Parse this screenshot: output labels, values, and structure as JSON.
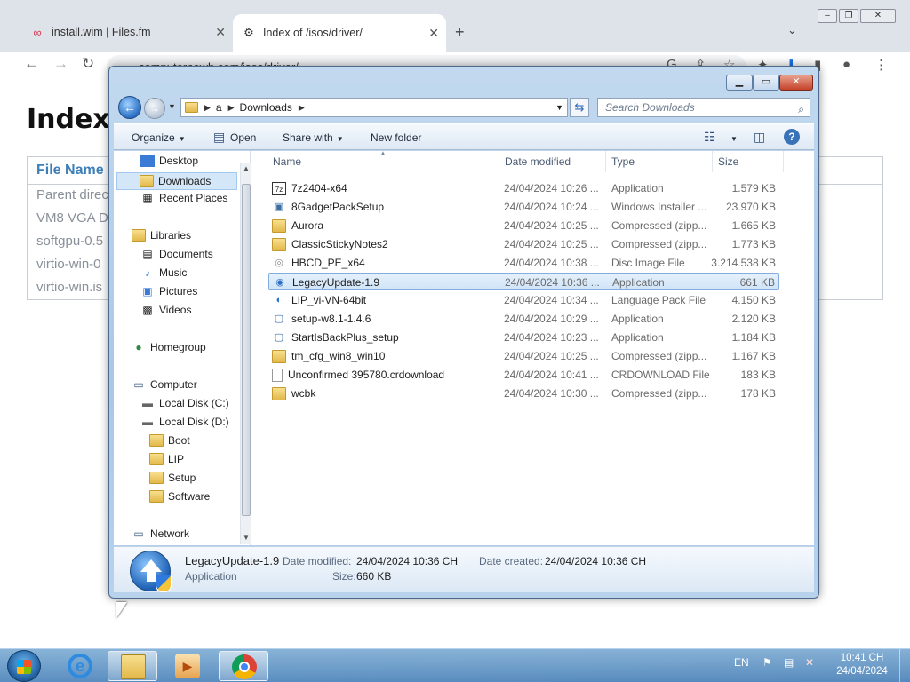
{
  "browser": {
    "tabs": [
      {
        "title": "install.wim | Files.fm",
        "icon": "files-fm-icon"
      },
      {
        "title": "Index of /isos/driver/",
        "icon": "server-icon"
      }
    ],
    "url": "computernewb.com/isos/driver/",
    "page": {
      "title": "Index",
      "column_header": "File Name",
      "rows": [
        "Parent direc",
        "VM8 VGA D",
        "softgpu-0.5",
        "virtio-win-0",
        "virtio-win.is"
      ]
    }
  },
  "explorer": {
    "breadcrumb": [
      "a",
      "Downloads"
    ],
    "search_placeholder": "Search Downloads",
    "commands": {
      "organize": "Organize",
      "open": "Open",
      "share_with": "Share with",
      "new_folder": "New folder"
    },
    "nav": {
      "favorites": [
        "Desktop",
        "Downloads",
        "Recent Places"
      ],
      "libraries": "Libraries",
      "library_items": [
        "Documents",
        "Music",
        "Pictures",
        "Videos"
      ],
      "homegroup": "Homegroup",
      "computer": "Computer",
      "drives": [
        "Local Disk (C:)",
        "Local Disk (D:)"
      ],
      "d_folders": [
        "Boot",
        "LIP",
        "Setup",
        "Software"
      ],
      "network": "Network"
    },
    "columns": {
      "name": "Name",
      "date": "Date modified",
      "type": "Type",
      "size": "Size"
    },
    "files": [
      {
        "name": "7z2404-x64",
        "date": "24/04/2024 10:26 ...",
        "type": "Application",
        "size": "1.579 KB",
        "icon": "app-icon"
      },
      {
        "name": "8GadgetPackSetup",
        "date": "24/04/2024 10:24 ...",
        "type": "Windows Installer ...",
        "size": "23.970 KB",
        "icon": "installer-icon"
      },
      {
        "name": "Aurora",
        "date": "24/04/2024 10:25 ...",
        "type": "Compressed (zipp...",
        "size": "1.665 KB",
        "icon": "zip-folder-icon"
      },
      {
        "name": "ClassicStickyNotes2",
        "date": "24/04/2024 10:25 ...",
        "type": "Compressed (zipp...",
        "size": "1.773 KB",
        "icon": "zip-folder-icon"
      },
      {
        "name": "HBCD_PE_x64",
        "date": "24/04/2024 10:38 ...",
        "type": "Disc Image File",
        "size": "3.214.538 KB",
        "icon": "disc-image-icon"
      },
      {
        "name": "LegacyUpdate-1.9",
        "date": "24/04/2024 10:36 ...",
        "type": "Application",
        "size": "661 KB",
        "icon": "legacy-update-icon"
      },
      {
        "name": "LIP_vi-VN-64bit",
        "date": "24/04/2024 10:34 ...",
        "type": "Language Pack File",
        "size": "4.150 KB",
        "icon": "language-pack-icon"
      },
      {
        "name": "setup-w8.1-1.4.6",
        "date": "24/04/2024 10:29 ...",
        "type": "Application",
        "size": "2.120 KB",
        "icon": "app-icon"
      },
      {
        "name": "StartIsBackPlus_setup",
        "date": "24/04/2024 10:23 ...",
        "type": "Application",
        "size": "1.184 KB",
        "icon": "app-icon"
      },
      {
        "name": "tm_cfg_win8_win10",
        "date": "24/04/2024 10:25 ...",
        "type": "Compressed (zipp...",
        "size": "1.167 KB",
        "icon": "zip-folder-icon"
      },
      {
        "name": "Unconfirmed 395780.crdownload",
        "date": "24/04/2024 10:41 ...",
        "type": "CRDOWNLOAD File",
        "size": "183 KB",
        "icon": "blank-file-icon"
      },
      {
        "name": "wcbk",
        "date": "24/04/2024 10:30 ...",
        "type": "Compressed (zipp...",
        "size": "178 KB",
        "icon": "zip-folder-icon"
      }
    ],
    "details": {
      "name": "LegacyUpdate-1.9",
      "kind": "Application",
      "modified_label": "Date modified:",
      "modified": "24/04/2024 10:36 CH",
      "created_label": "Date created:",
      "created": "24/04/2024 10:36 CH",
      "size_label": "Size:",
      "size": "660 KB"
    }
  },
  "taskbar": {
    "language": "EN",
    "time": "10:41 CH",
    "date": "24/04/2024"
  }
}
